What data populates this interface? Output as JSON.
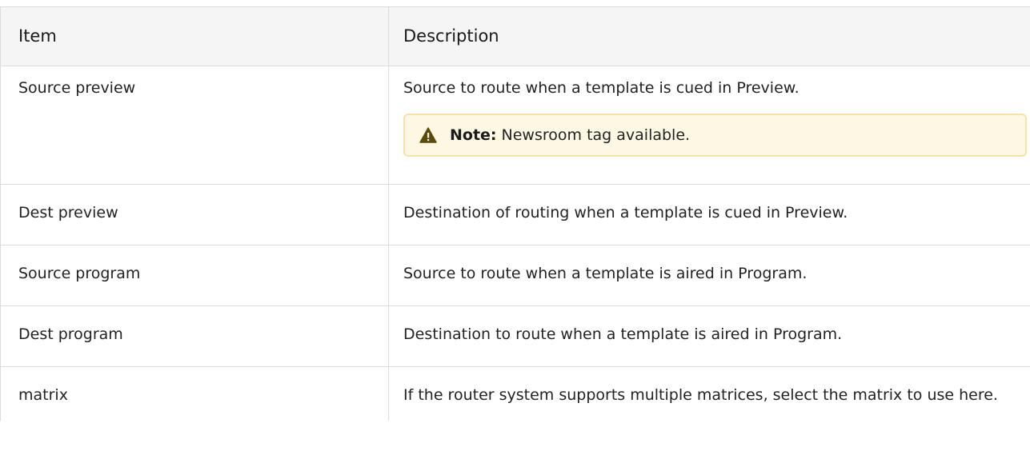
{
  "table": {
    "headers": {
      "item": "Item",
      "description": "Description"
    },
    "rows": [
      {
        "item": "Source preview",
        "description": "Source to route when a template is cued in Preview.",
        "note": {
          "label": "Note:",
          "text": "Newsroom tag available.",
          "icon": "warning-icon",
          "background": "#fdf8e4",
          "border": "#f4e2a6"
        }
      },
      {
        "item": "Dest preview",
        "description": "Destination of routing when a template is cued in Preview."
      },
      {
        "item": "Source program",
        "description": "Source to route when a template is aired in Program."
      },
      {
        "item": "Dest program",
        "description": "Destination to route when a template is aired in Program."
      },
      {
        "item": "matrix",
        "description": "If the router system supports multiple matrices, select the matrix to use here."
      }
    ]
  }
}
